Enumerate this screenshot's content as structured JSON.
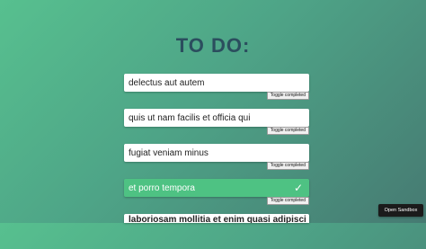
{
  "header": {
    "title": "TO DO:"
  },
  "todos": [
    {
      "text": "delectus aut autem",
      "toggle_label": "Toggle completed",
      "completed": false
    },
    {
      "text": "quis ut nam facilis et officia qui",
      "toggle_label": "Toggle completed",
      "completed": false
    },
    {
      "text": "fugiat veniam minus",
      "toggle_label": "Toggle completed",
      "completed": false
    },
    {
      "text": "et porro tempora",
      "toggle_label": "Toggle completed",
      "completed": true,
      "check_glyph": "✓"
    },
    {
      "text": "laboriosam mollitia et enim quasi adipisci quia pr",
      "completed": false
    }
  ],
  "sandbox": {
    "label": "Open Sandbox"
  },
  "colors": {
    "title": "#2b4e5e",
    "completed_card": "#4ec283",
    "background_start": "#57c08f",
    "background_end": "#467a72"
  }
}
